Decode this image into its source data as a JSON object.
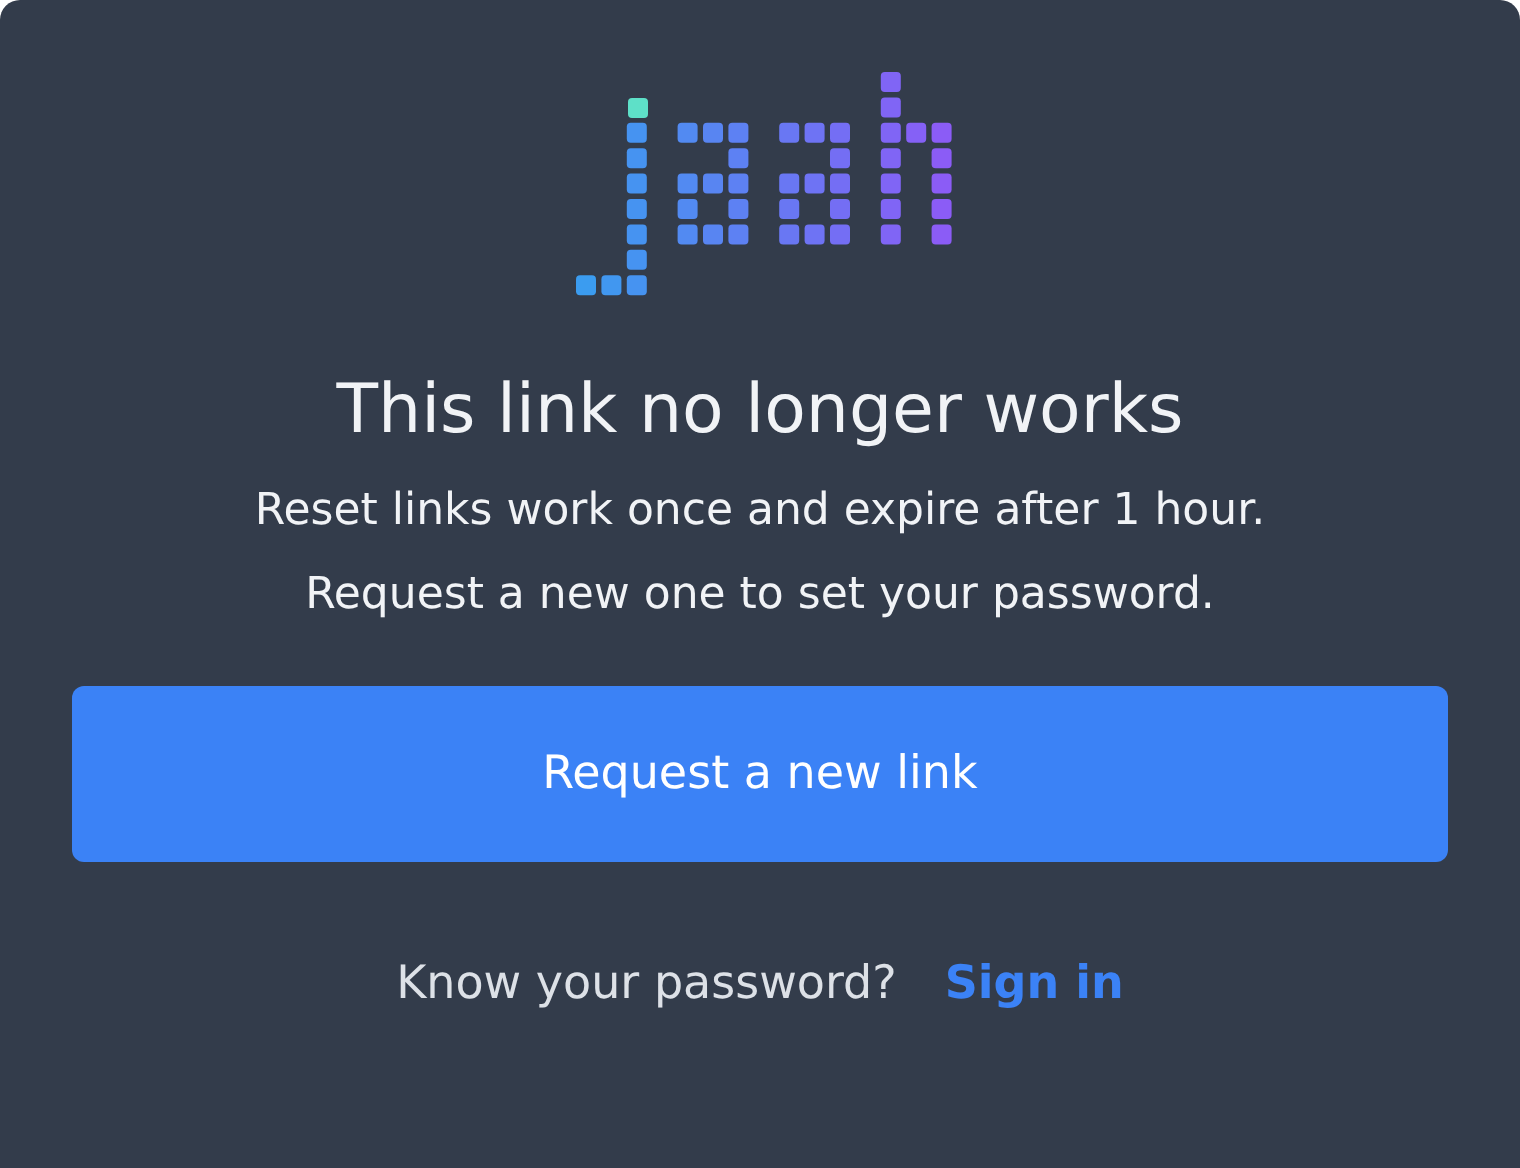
{
  "title": "This link no longer works",
  "message": [
    "Reset links work once and expire after 1 hour.",
    "Request a new one to set your password."
  ],
  "primary_button": "Request a new link",
  "footer": {
    "prompt": "Know your password?",
    "link": "Sign in"
  }
}
